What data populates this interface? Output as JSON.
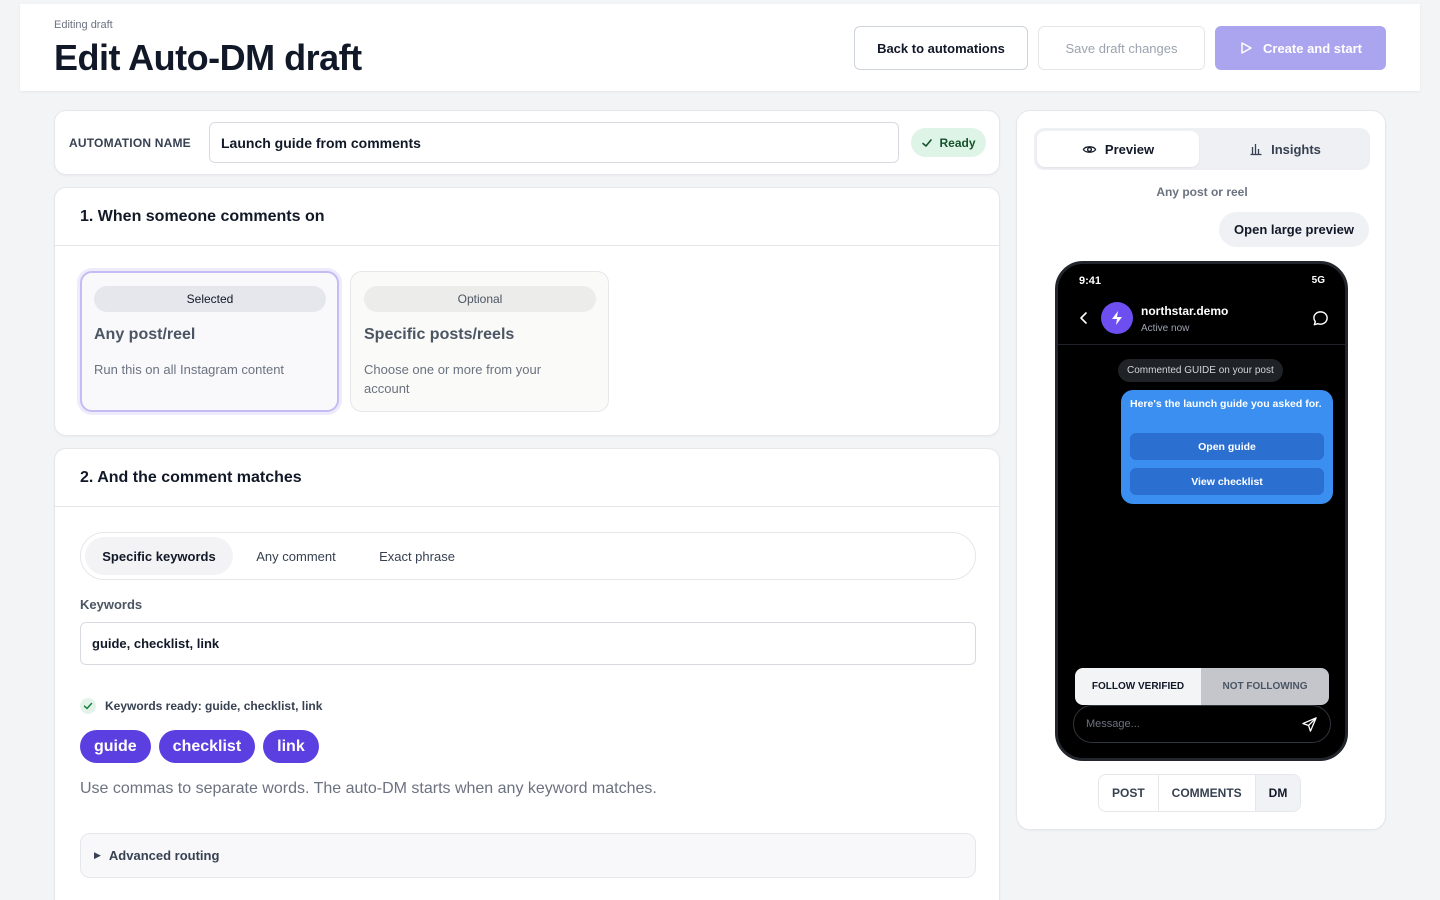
{
  "header": {
    "eyebrow": "Editing draft",
    "title": "Edit Auto-DM draft",
    "back_label": "Back to automations",
    "save_label": "Save draft changes",
    "create_label": "Create and start"
  },
  "automation": {
    "name_label": "AUTOMATION NAME",
    "name_value": "Launch guide from comments",
    "status": "Ready"
  },
  "trigger": {
    "title": "1. When someone comments on",
    "options": [
      {
        "pill": "Selected",
        "title": "Any post/reel",
        "desc": "Run this on all Instagram content"
      },
      {
        "pill": "Optional",
        "title": "Specific posts/reels",
        "desc": "Choose one or more from your account"
      }
    ]
  },
  "match": {
    "title": "2. And the comment matches",
    "tabs": [
      "Specific keywords",
      "Any comment",
      "Exact phrase"
    ],
    "keywords_label": "Keywords",
    "keywords_value": "guide, checklist, link",
    "ready_text": "Keywords ready: guide, checklist, link",
    "chips": [
      "guide",
      "checklist",
      "link"
    ],
    "helper": "Use commas to separate words. The auto-DM starts when any keyword matches.",
    "advanced_label": "Advanced routing"
  },
  "preview": {
    "tabs": [
      "Preview",
      "Insights"
    ],
    "scope": "Any post or reel",
    "large_label": "Open large preview",
    "view_tabs": [
      "POST",
      "COMMENTS",
      "DM"
    ]
  },
  "phone": {
    "time": "9:41",
    "network": "5G",
    "username": "northstar.demo",
    "status": "Active now",
    "event": "Commented GUIDE on your post",
    "message": "Here's the launch guide you asked for.",
    "buttons": [
      "Open guide",
      "View checklist"
    ],
    "follow_on": "FOLLOW VERIFIED",
    "follow_off": "NOT FOLLOWING",
    "input_placeholder": "Message..."
  },
  "colors": {
    "accent": "#5b3fe0",
    "create_button": "#aba4ef",
    "ready_badge": "#def4e6",
    "dm_bubble": "#3b8ff0"
  },
  "icons": [
    "play-icon",
    "check-icon",
    "eye-icon",
    "bar-chart-icon",
    "chevron-left-icon",
    "bolt-icon",
    "chat-bubble-icon",
    "send-icon",
    "caret-right-icon"
  ]
}
